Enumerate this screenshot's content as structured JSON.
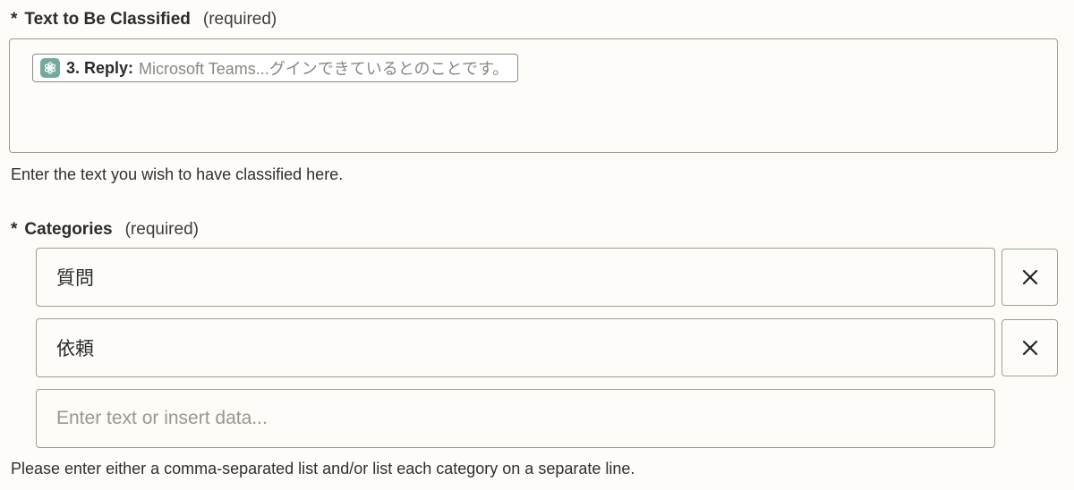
{
  "text_field": {
    "required_marker": "*",
    "label": "Text to Be Classified",
    "required_note": "(required)",
    "token": {
      "app_icon": "openai-icon",
      "step_label": "3. Reply:",
      "preview": "Microsoft Teams...グインできているとのことです。"
    },
    "hint": "Enter the text you wish to have classified here."
  },
  "categories_field": {
    "required_marker": "*",
    "label": "Categories",
    "required_note": "(required)",
    "items": [
      {
        "value": "質問",
        "remove_icon": "close-icon"
      },
      {
        "value": "依頼",
        "remove_icon": "close-icon"
      }
    ],
    "new_item_placeholder": "Enter text or insert data...",
    "hint": "Please enter either a comma-separated list and/or list each category on a separate line."
  },
  "colors": {
    "background": "#fdfcf9",
    "border": "#a19d94",
    "icon_green": "#74aa9c",
    "placeholder": "#9b978f"
  }
}
